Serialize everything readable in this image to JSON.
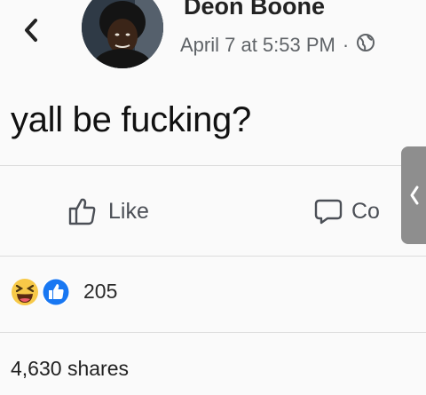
{
  "post": {
    "author_name": "Deon Boone",
    "timestamp": "April 7 at 5:53 PM",
    "separator": "·",
    "privacy_icon": "globe-icon",
    "text": "yall be fucking?"
  },
  "actions": {
    "back_icon": "chevron-left-icon",
    "like_label": "Like",
    "like_icon": "thumbs-up-outline-icon",
    "comment_label": "Co",
    "comment_icon": "speech-bubble-icon"
  },
  "side_handle": {
    "icon": "chevron-left-icon"
  },
  "reactions": {
    "icons": [
      "haha-icon",
      "like-icon"
    ],
    "count": "205"
  },
  "shares": {
    "label": "4,630 shares"
  },
  "colors": {
    "like_blue": "#1877f2",
    "haha_yellow": "#f7c948",
    "meta_gray": "#5f6367"
  }
}
